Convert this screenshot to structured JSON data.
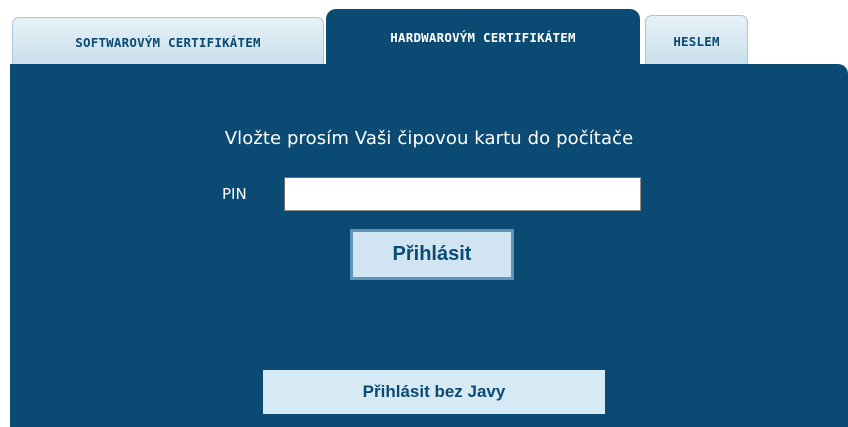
{
  "tabs": {
    "software": "SOFTWAROVÝM CERTIFIKÁTEM",
    "hardware": "HARDWAROVÝM CERTIFIKÁTEM",
    "password": "HESLEM",
    "active": "hardware"
  },
  "panel": {
    "prompt": "Vložte prosím Vaši čipovou kartu do počítače",
    "pin_label": "PIN",
    "pin_value": "",
    "login_button": "Přihlásit",
    "no_java_button": "Přihlásit bez Javy"
  },
  "colors": {
    "panel_bg": "#0a4a73",
    "tab_inactive_bg": "#d6e8f2",
    "button_bg": "#d0e5f1"
  }
}
